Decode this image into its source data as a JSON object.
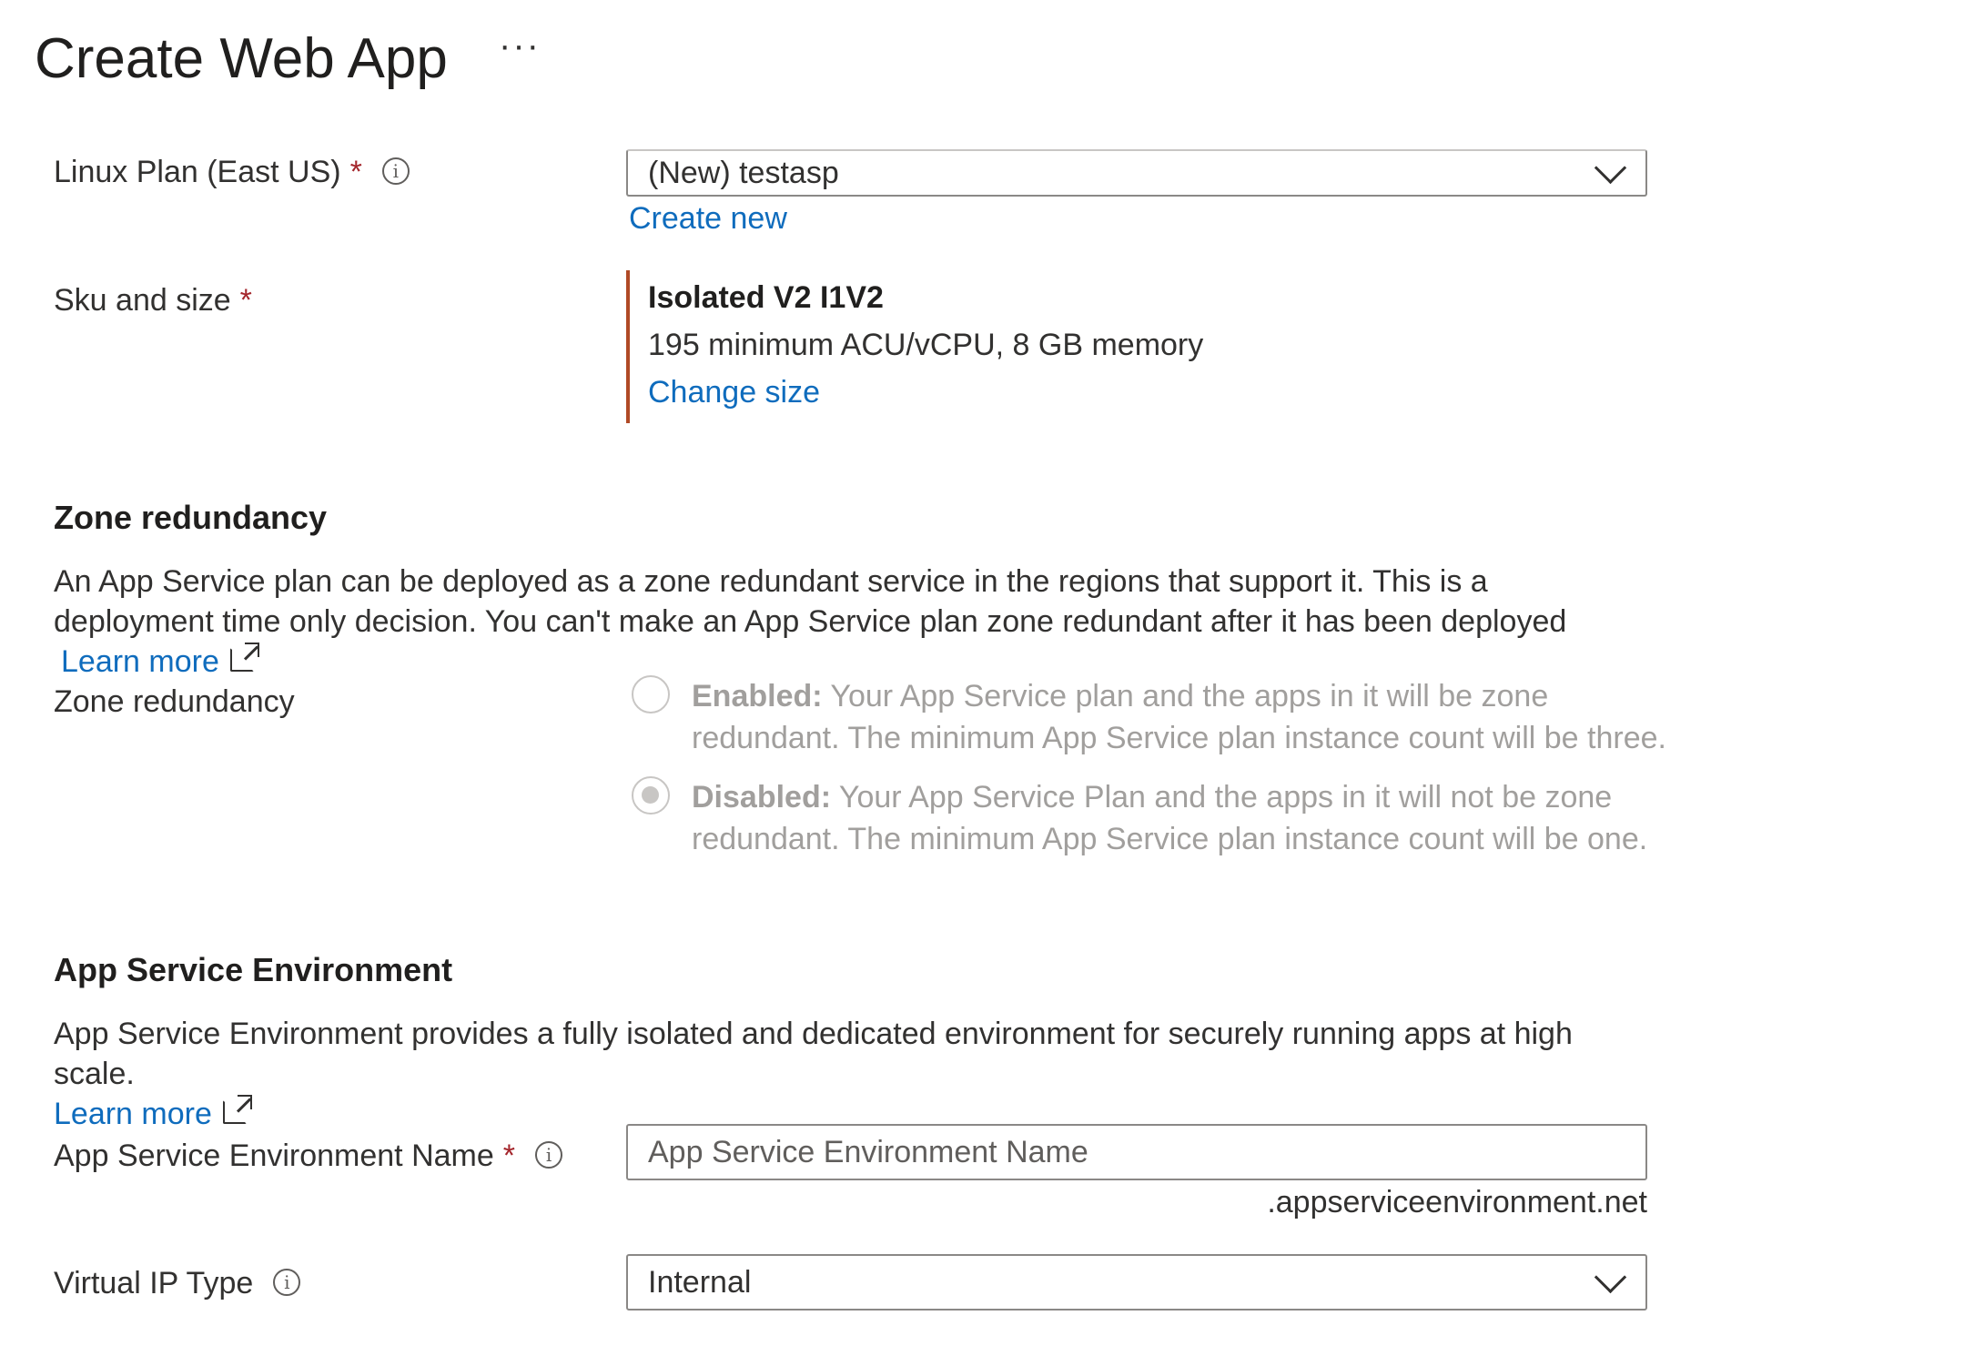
{
  "page": {
    "title": "Create Web App",
    "more_label": "···"
  },
  "linux_plan": {
    "label": "Linux Plan (East US)",
    "required": "*",
    "value": "(New) testasp",
    "create_new": "Create new"
  },
  "sku": {
    "label": "Sku and size",
    "required": "*",
    "name": "Isolated V2 I1V2",
    "description": "195 minimum ACU/vCPU, 8 GB memory",
    "change_size": "Change size"
  },
  "zone_redundancy": {
    "heading": "Zone redundancy",
    "description": "An App Service plan can be deployed as a zone redundant service in the regions that support it. This is a deployment time only decision. You can't make an App Service plan zone redundant after it has been deployed",
    "learn_more": "Learn more",
    "field_label": "Zone redundancy",
    "options": [
      {
        "title": "Enabled:",
        "text": "Your App Service plan and the apps in it will be zone redundant. The minimum App Service plan instance count will be three.",
        "selected": false
      },
      {
        "title": "Disabled:",
        "text": "Your App Service Plan and the apps in it will not be zone redundant. The minimum App Service plan instance count will be one.",
        "selected": true
      }
    ]
  },
  "ase": {
    "heading": "App Service Environment",
    "description": "App Service Environment provides a fully isolated and dedicated environment for securely running apps at high scale.",
    "learn_more": "Learn more",
    "name_label": "App Service Environment Name",
    "required": "*",
    "name_placeholder": "App Service Environment Name",
    "name_value": "",
    "suffix": ".appserviceenvironment.net",
    "vip_label": "Virtual IP Type",
    "vip_value": "Internal"
  },
  "colors": {
    "link": "#0f6cbd",
    "required": "#a4262c",
    "sku_accent": "#b04a26",
    "disabled_text": "#a19f9d"
  }
}
